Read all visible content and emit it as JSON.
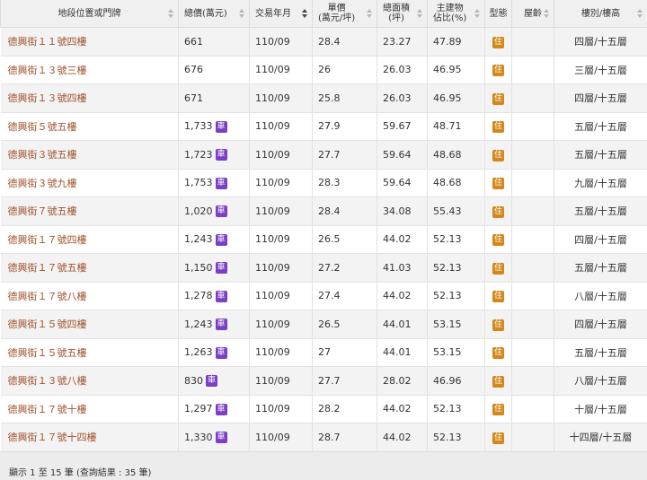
{
  "columns": [
    {
      "label": "地段位置或門牌",
      "sortable": true,
      "active": false
    },
    {
      "label": "總價(萬元)",
      "sortable": true,
      "active": false
    },
    {
      "label": "交易年月",
      "sortable": true,
      "active": true
    },
    {
      "label": "單價\n(萬元/坪)",
      "sortable": true,
      "active": false
    },
    {
      "label": "總面積\n(坪)",
      "sortable": true,
      "active": false
    },
    {
      "label": "主建物\n佔比(%)",
      "sortable": true,
      "active": false
    },
    {
      "label": "型態",
      "sortable": false,
      "active": false
    },
    {
      "label": "屋齡",
      "sortable": true,
      "active": false
    },
    {
      "label": "樓別/樓高",
      "sortable": true,
      "active": false
    }
  ],
  "badges": {
    "car": "車",
    "residence": "住"
  },
  "rows": [
    {
      "address": "德興街１１號四樓",
      "price": "661",
      "car": false,
      "date": "110/09",
      "unit": "28.4",
      "area": "23.27",
      "ratio": "47.89",
      "age": "",
      "floor": "四層/十五層"
    },
    {
      "address": "德興街１３號三樓",
      "price": "676",
      "car": false,
      "date": "110/09",
      "unit": "26",
      "area": "26.03",
      "ratio": "46.95",
      "age": "",
      "floor": "三層/十五層"
    },
    {
      "address": "德興街１３號四樓",
      "price": "671",
      "car": false,
      "date": "110/09",
      "unit": "25.8",
      "area": "26.03",
      "ratio": "46.95",
      "age": "",
      "floor": "四層/十五層"
    },
    {
      "address": "德興街５號五樓",
      "price": "1,733",
      "car": true,
      "date": "110/09",
      "unit": "27.9",
      "area": "59.67",
      "ratio": "48.71",
      "age": "",
      "floor": "五層/十五層"
    },
    {
      "address": "德興街３號五樓",
      "price": "1,723",
      "car": true,
      "date": "110/09",
      "unit": "27.7",
      "area": "59.64",
      "ratio": "48.68",
      "age": "",
      "floor": "五層/十五層"
    },
    {
      "address": "德興街３號九樓",
      "price": "1,753",
      "car": true,
      "date": "110/09",
      "unit": "28.3",
      "area": "59.64",
      "ratio": "48.68",
      "age": "",
      "floor": "九層/十五層"
    },
    {
      "address": "德興街７號五樓",
      "price": "1,020",
      "car": true,
      "date": "110/09",
      "unit": "28.4",
      "area": "34.08",
      "ratio": "55.43",
      "age": "",
      "floor": "五層/十五層"
    },
    {
      "address": "德興街１７號四樓",
      "price": "1,243",
      "car": true,
      "date": "110/09",
      "unit": "26.5",
      "area": "44.02",
      "ratio": "52.13",
      "age": "",
      "floor": "四層/十五層"
    },
    {
      "address": "德興街１７號五樓",
      "price": "1,150",
      "car": true,
      "date": "110/09",
      "unit": "27.2",
      "area": "41.03",
      "ratio": "52.13",
      "age": "",
      "floor": "五層/十五層"
    },
    {
      "address": "德興街１７號八樓",
      "price": "1,278",
      "car": true,
      "date": "110/09",
      "unit": "27.4",
      "area": "44.02",
      "ratio": "52.13",
      "age": "",
      "floor": "八層/十五層"
    },
    {
      "address": "德興街１５號四樓",
      "price": "1,243",
      "car": true,
      "date": "110/09",
      "unit": "26.5",
      "area": "44.01",
      "ratio": "53.15",
      "age": "",
      "floor": "四層/十五層"
    },
    {
      "address": "德興街１５號五樓",
      "price": "1,263",
      "car": true,
      "date": "110/09",
      "unit": "27",
      "area": "44.01",
      "ratio": "53.15",
      "age": "",
      "floor": "五層/十五層"
    },
    {
      "address": "德興街１３號八樓",
      "price": "830",
      "car": true,
      "date": "110/09",
      "unit": "27.7",
      "area": "28.02",
      "ratio": "46.96",
      "age": "",
      "floor": "八層/十五層"
    },
    {
      "address": "德興街１７號十樓",
      "price": "1,297",
      "car": true,
      "date": "110/09",
      "unit": "28.2",
      "area": "44.02",
      "ratio": "52.13",
      "age": "",
      "floor": "十層/十五層"
    },
    {
      "address": "德興街１７號十四樓",
      "price": "1,330",
      "car": true,
      "date": "110/09",
      "unit": "28.7",
      "area": "44.02",
      "ratio": "52.13",
      "age": "",
      "floor": "十四層/十五層"
    }
  ],
  "footer": {
    "text": "顯示 1 至 15 筆 (查詢結果 : 35 筆)"
  }
}
